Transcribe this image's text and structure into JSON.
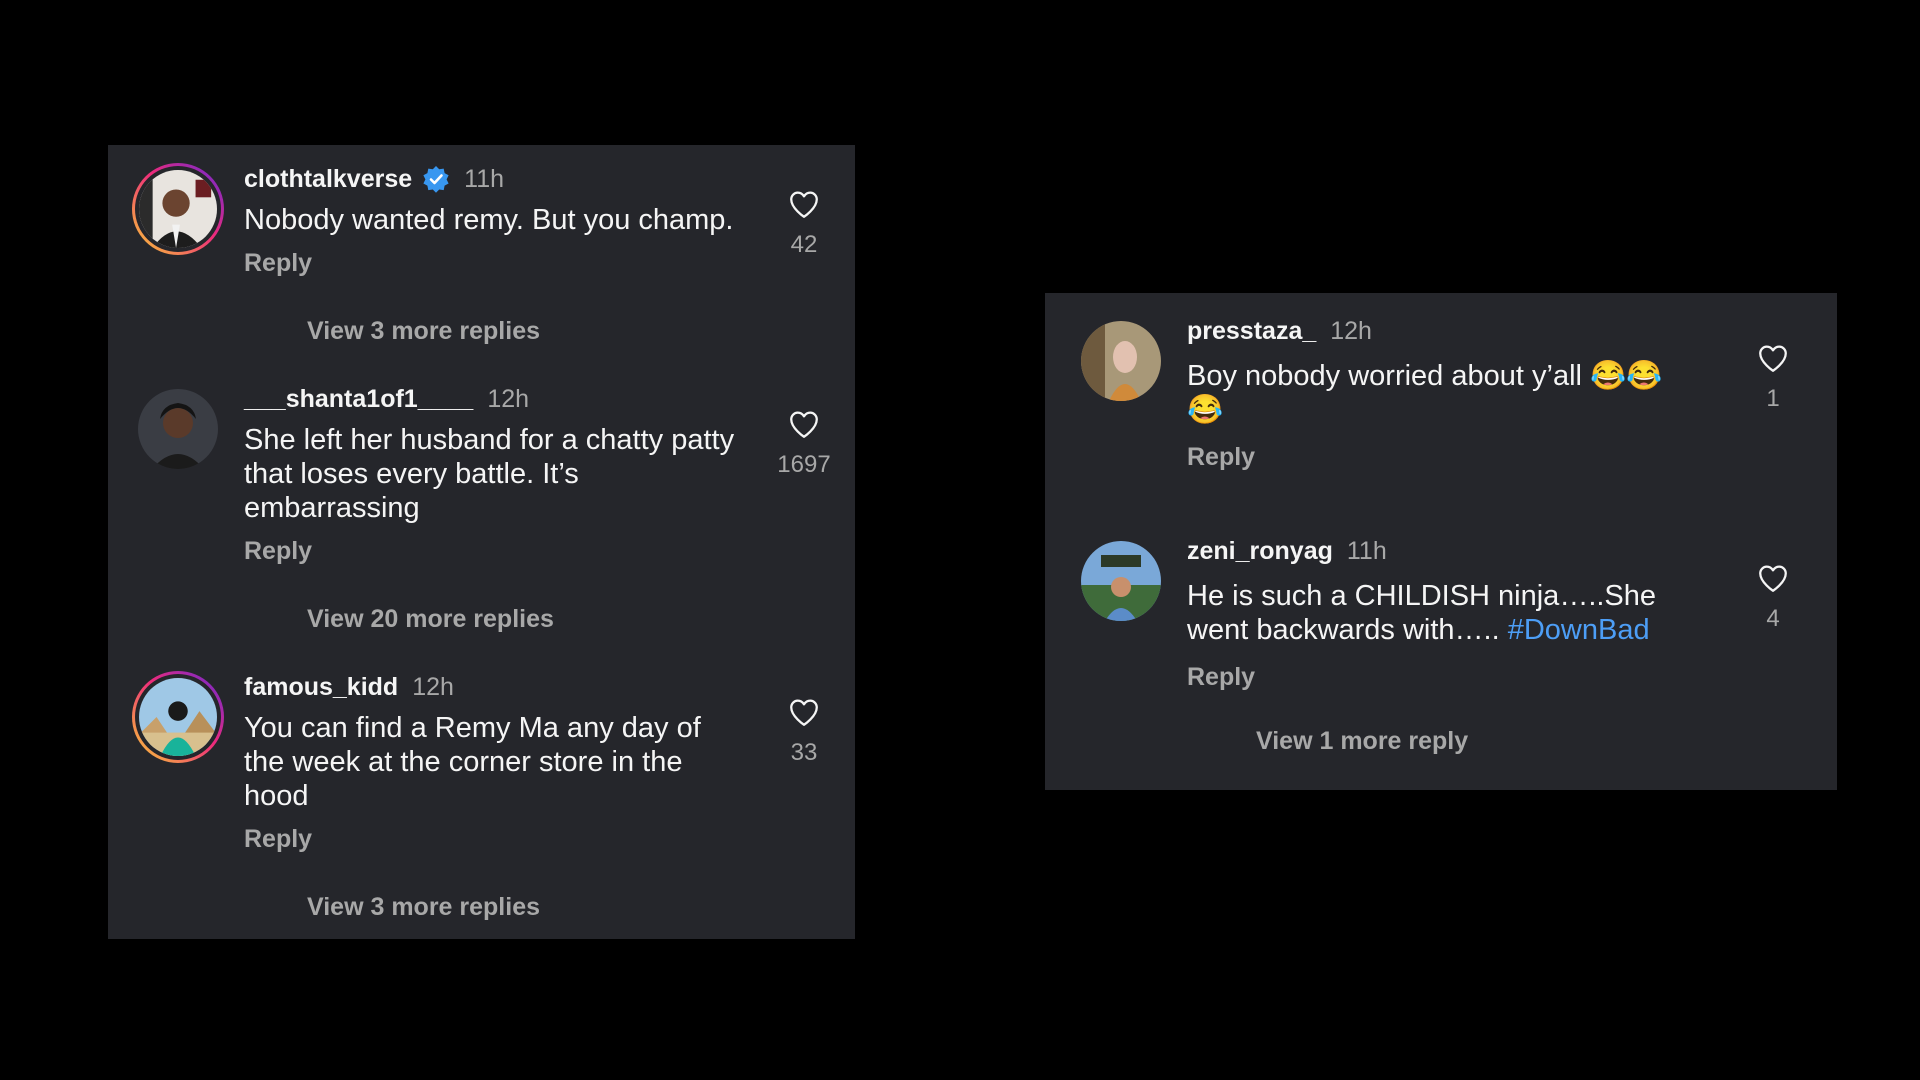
{
  "left_panel": {
    "comments": [
      {
        "username": "clothtalkverse",
        "verified": true,
        "time": "11h",
        "text": "Nobody wanted remy. But you champ.",
        "reply": "Reply",
        "likes": "42",
        "view_more": "View 3 more replies"
      },
      {
        "username": "___shanta1of1____",
        "verified": false,
        "time": "12h",
        "text": "She left her husband for a chatty patty that loses every battle. It’s embarrassing",
        "reply": "Reply",
        "likes": "1697",
        "view_more": "View 20 more replies"
      },
      {
        "username": "famous_kidd",
        "verified": false,
        "time": "12h",
        "text": "You can find a Remy Ma any day of the week at the corner store in the hood",
        "reply": "Reply",
        "likes": "33",
        "view_more": "View 3 more replies"
      }
    ]
  },
  "right_panel": {
    "comments": [
      {
        "username": "presstaza_",
        "time": "12h",
        "text": "Boy nobody worried about y’all 😂😂😂",
        "reply": "Reply",
        "likes": "1"
      },
      {
        "username": "zeni_ronyag",
        "time": "11h",
        "text_before": "He is such a CHILDISH ninja…..She went backwards with….. ",
        "hashtag": "#DownBad",
        "reply": "Reply",
        "likes": "4",
        "view_more": "View 1 more reply"
      }
    ]
  },
  "colors": {
    "background": "#000000",
    "panel": "#25262b",
    "primary_text": "#f5f5f5",
    "secondary_text": "#a8a8a8",
    "hashtag": "#4d9ef6",
    "verified": "#3897f0"
  },
  "icons": {
    "like": "heart-outline-icon",
    "verified": "verified-badge-icon"
  }
}
